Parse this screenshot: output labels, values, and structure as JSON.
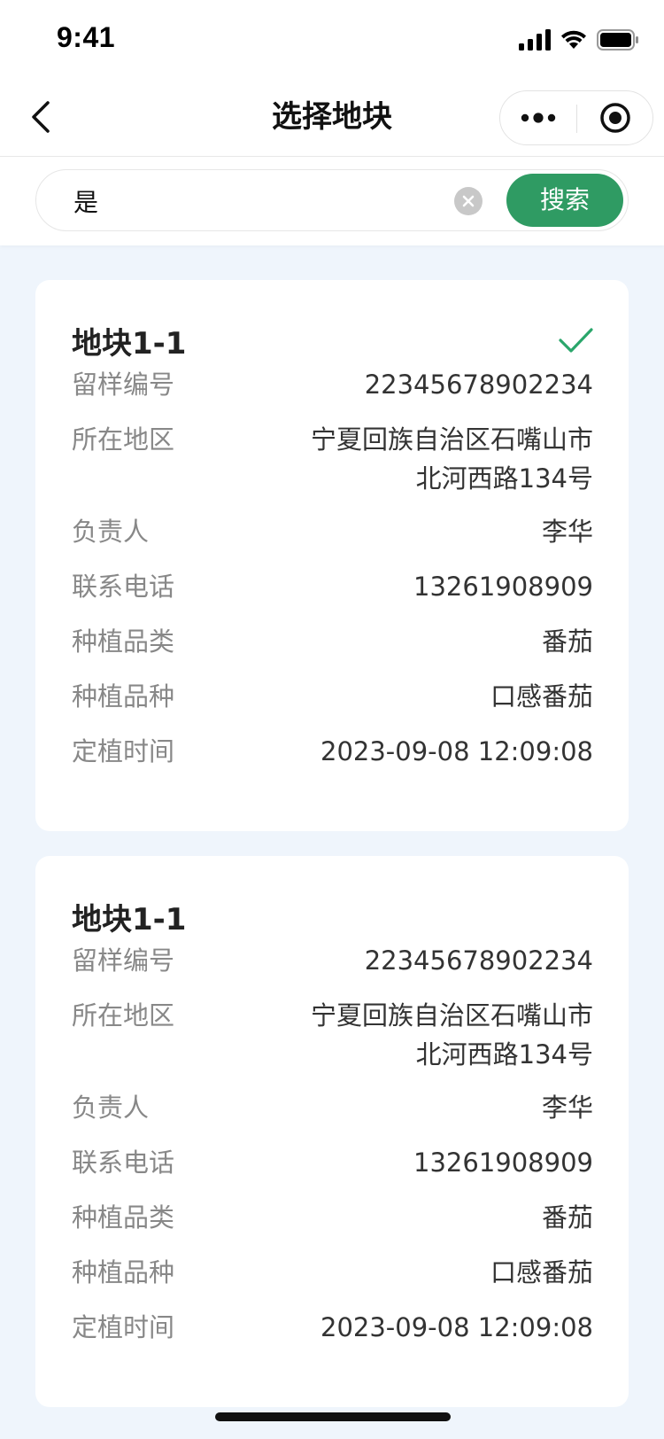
{
  "status_bar": {
    "time": "9:41"
  },
  "nav": {
    "title": "选择地块"
  },
  "search": {
    "value": "是",
    "button_label": "搜索"
  },
  "colors": {
    "accent": "#2f9b63",
    "check": "#2aa66b",
    "background": "#eff5fc"
  },
  "cards": [
    {
      "title": "地块1-1",
      "selected": true,
      "fields": [
        {
          "label": "留样编号",
          "value": "22345678902234"
        },
        {
          "label": "所在地区",
          "value": "宁夏回族自治区石嘴山市\n北河西路134号"
        },
        {
          "label": "负责人",
          "value": "李华"
        },
        {
          "label": "联系电话",
          "value": "13261908909"
        },
        {
          "label": "种植品类",
          "value": "番茄"
        },
        {
          "label": "种植品种",
          "value": "口感番茄"
        },
        {
          "label": "定植时间",
          "value": "2023-09-08 12:09:08"
        }
      ]
    },
    {
      "title": "地块1-1",
      "selected": false,
      "fields": [
        {
          "label": "留样编号",
          "value": "22345678902234"
        },
        {
          "label": "所在地区",
          "value": "宁夏回族自治区石嘴山市\n北河西路134号"
        },
        {
          "label": "负责人",
          "value": "李华"
        },
        {
          "label": "联系电话",
          "value": "13261908909"
        },
        {
          "label": "种植品类",
          "value": "番茄"
        },
        {
          "label": "种植品种",
          "value": "口感番茄"
        },
        {
          "label": "定植时间",
          "value": "2023-09-08 12:09:08"
        }
      ]
    }
  ]
}
